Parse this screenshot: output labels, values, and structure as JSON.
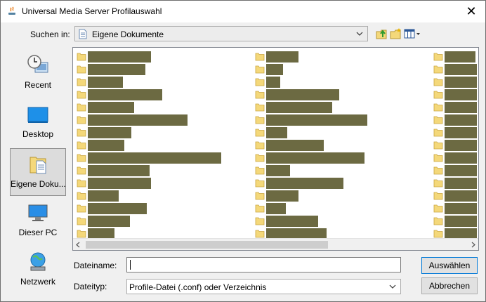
{
  "window": {
    "title": "Universal Media Server Profilauswahl",
    "close_symbol": "✕"
  },
  "lookin": {
    "label": "Suchen in:",
    "value": "Eigene Dokumente"
  },
  "places": [
    {
      "label": "Recent",
      "icon": "recent-icon"
    },
    {
      "label": "Desktop",
      "icon": "desktop-icon"
    },
    {
      "label": "Eigene Doku...",
      "icon": "documents-icon",
      "selected": true
    },
    {
      "label": "Dieser PC",
      "icon": "computer-icon"
    },
    {
      "label": "Netzwerk",
      "icon": "network-icon"
    }
  ],
  "filename": {
    "label": "Dateiname:",
    "value": ""
  },
  "filetype": {
    "label": "Dateityp:",
    "value": "Profile-Datei (.conf) oder Verzeichnis"
  },
  "buttons": {
    "select": "Auswählen",
    "cancel": "Abbrechen"
  },
  "colors": {
    "redaction": "#6c6a42",
    "folder": "#f4d87a",
    "selection_border": "#0078d7"
  }
}
